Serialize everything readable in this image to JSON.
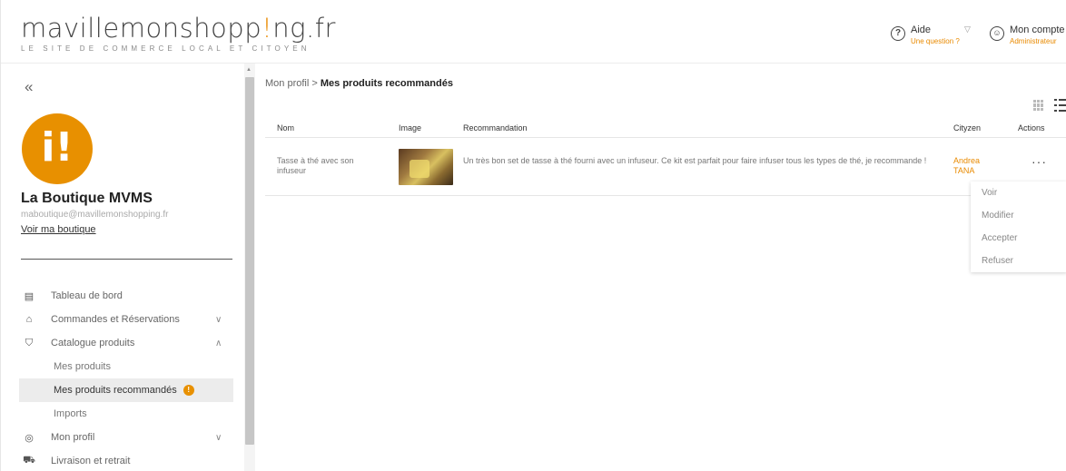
{
  "brand": {
    "logo_before": "mavillemonshopp",
    "logo_accent": "!",
    "logo_after": "ng.fr",
    "tagline": "LE SITE DE COMMERCE LOCAL ET CITOYEN"
  },
  "header": {
    "help_title": "Aide",
    "help_sub": "Une question ?",
    "account_title": "Mon compte",
    "account_sub": "Administrateur"
  },
  "sidebar": {
    "collapse_icon": "«",
    "avatar_text": "i!",
    "shop_name": "La Boutique MVMS",
    "shop_email": "maboutique@mavillemonshopping.fr",
    "shop_link": "Voir ma boutique",
    "items": [
      {
        "label": "Tableau de bord",
        "icon": "dashboard-icon"
      },
      {
        "label": "Commandes et Réservations",
        "icon": "shopping-bag-icon"
      },
      {
        "label": "Catalogue produits",
        "icon": "tshirt-icon"
      },
      {
        "label": "Mon profil",
        "icon": "user-circle-icon"
      },
      {
        "label": "Livraison et retrait",
        "icon": "truck-icon"
      }
    ],
    "sub_items": [
      {
        "label": "Mes produits"
      },
      {
        "label": "Mes produits recommandés",
        "badge": "!"
      },
      {
        "label": "Imports"
      }
    ]
  },
  "main": {
    "breadcrumb_parent": "Mon profil",
    "breadcrumb_sep": ">",
    "breadcrumb_current": "Mes produits recommandés",
    "columns": {
      "name": "Nom",
      "image": "Image",
      "reco": "Recommandation",
      "user": "Cityzen",
      "actions": "Actions"
    },
    "rows": [
      {
        "name": "Tasse à thé avec son infuseur",
        "reco": "Un très bon set de tasse à thé fourni avec un infuseur. Ce kit est parfait pour faire infuser tous les types de thé, je recommande !",
        "user": "Andrea TANA",
        "actions_label": "···"
      }
    ],
    "menu": [
      "Voir",
      "Modifier",
      "Accepter",
      "Refuser"
    ]
  },
  "colors": {
    "accent": "#e89000",
    "active_bg": "#ececec"
  }
}
